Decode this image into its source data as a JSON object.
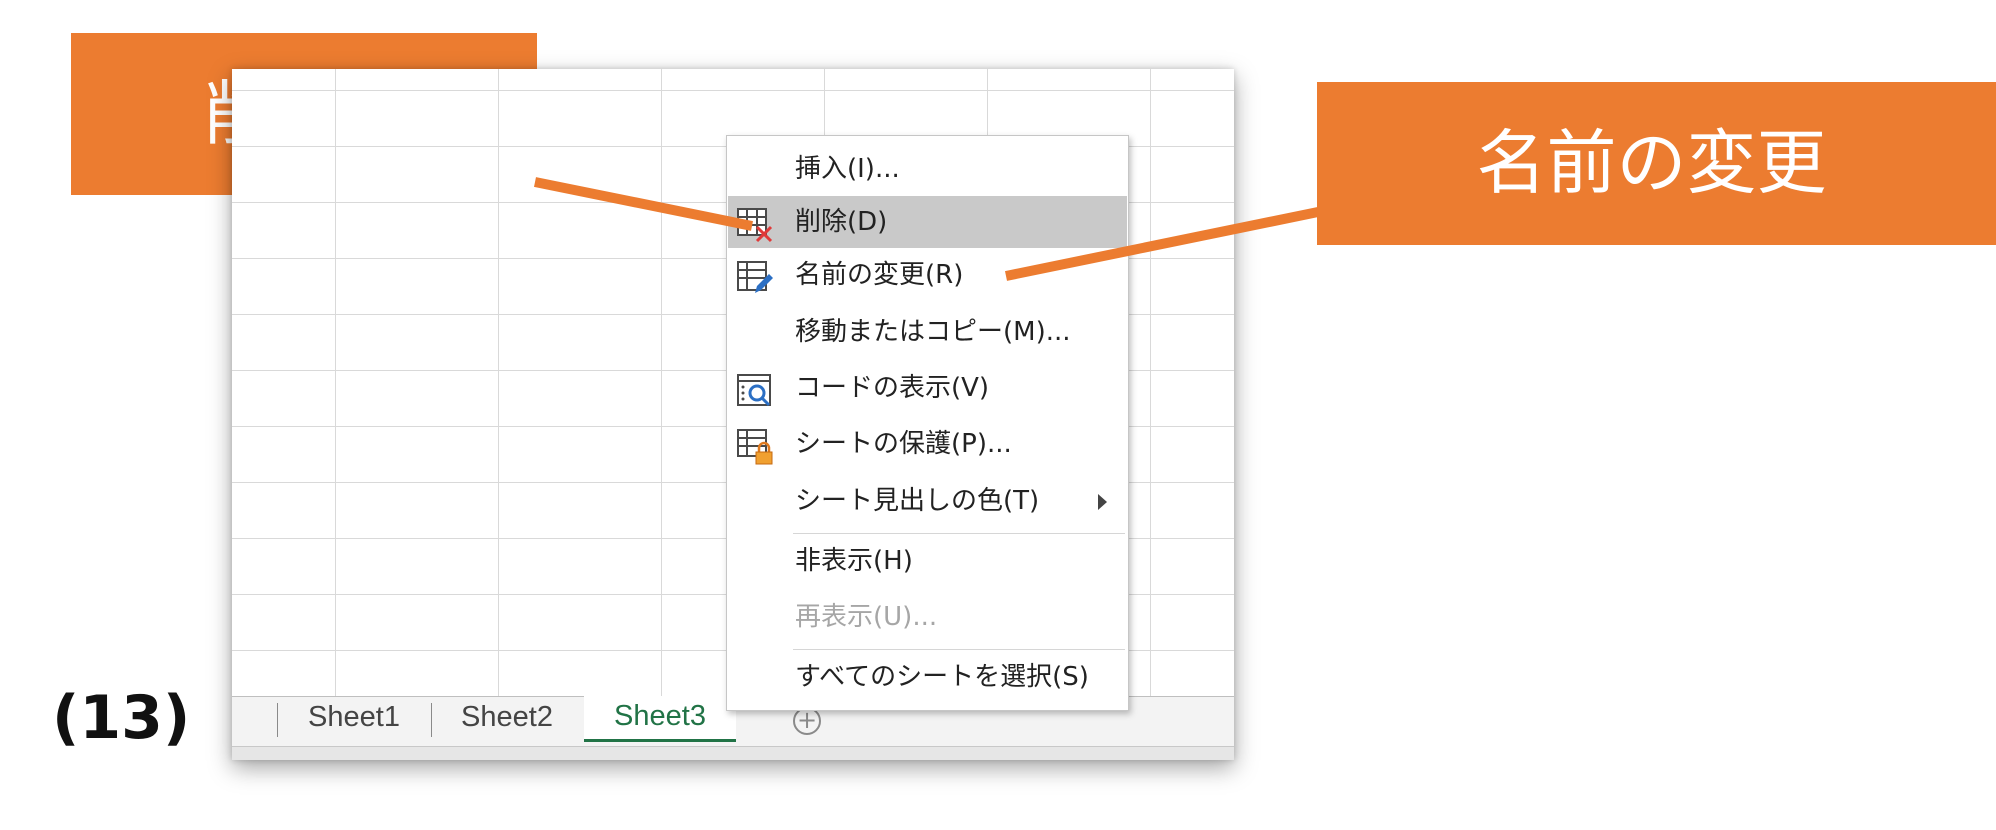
{
  "callouts": {
    "delete_label": "削除",
    "rename_label": "名前の変更"
  },
  "step_label": "(13)",
  "sheet_tabs": [
    "Sheet1",
    "Sheet2",
    "Sheet3"
  ],
  "active_sheet": "Sheet3",
  "add_sheet_symbol": "+",
  "context_menu": {
    "items": [
      {
        "label": "挿入(I)...",
        "icon": null,
        "highlighted": false,
        "disabled": false
      },
      {
        "label": "削除(D)",
        "icon": "delete-sheet-icon",
        "highlighted": true,
        "disabled": false
      },
      {
        "label": "名前の変更(R)",
        "icon": "rename-sheet-icon",
        "highlighted": false,
        "disabled": false
      },
      {
        "label": "移動またはコピー(M)...",
        "icon": null,
        "highlighted": false,
        "disabled": false
      },
      {
        "label": "コードの表示(V)",
        "icon": "view-code-icon",
        "highlighted": false,
        "disabled": false
      },
      {
        "label": "シートの保護(P)...",
        "icon": "protect-sheet-icon",
        "highlighted": false,
        "disabled": false
      },
      {
        "label": "シート見出しの色(T)",
        "icon": null,
        "highlighted": false,
        "disabled": false,
        "has_submenu": true
      },
      {
        "label": "非表示(H)",
        "icon": null,
        "highlighted": false,
        "disabled": false
      },
      {
        "label": "再表示(U)...",
        "icon": null,
        "highlighted": false,
        "disabled": true
      },
      {
        "label": "すべてのシートを選択(S)",
        "icon": null,
        "highlighted": false,
        "disabled": false
      }
    ]
  },
  "colors": {
    "callout": "#ec7c30",
    "active_tab": "#217346",
    "highlight": "#c9c9c9"
  }
}
